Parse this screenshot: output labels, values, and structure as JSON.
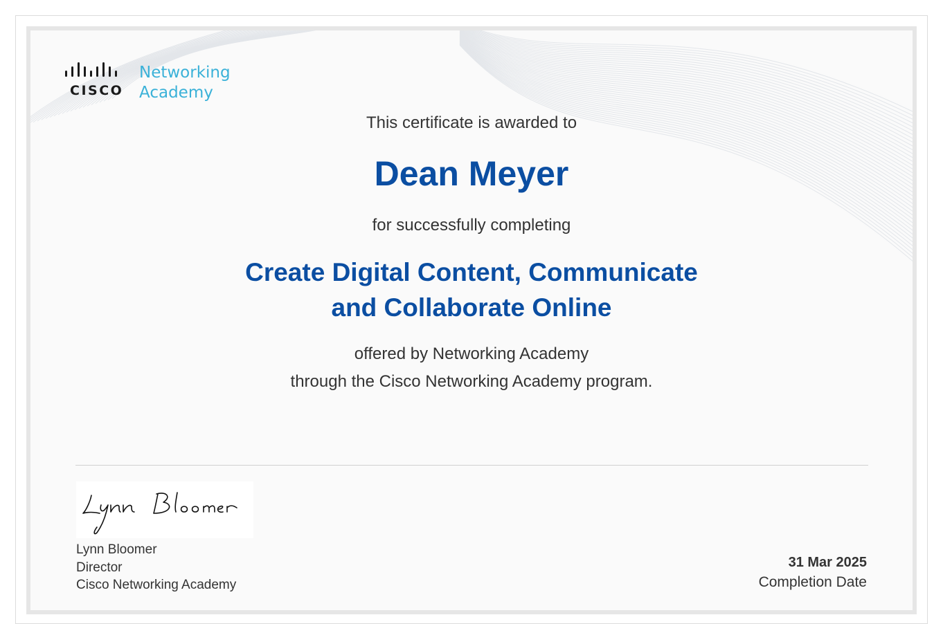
{
  "brand": {
    "cisco_wordmark": "CISCO",
    "academy_line1": "Networking",
    "academy_line2": "Academy",
    "accent_color": "#3ab1d8",
    "title_color": "#0b4ea2"
  },
  "certificate": {
    "awarded_text": "This certificate is awarded to",
    "recipient": "Dean Meyer",
    "completing_text": "for successfully completing",
    "course_line1": "Create Digital Content, Communicate",
    "course_line2": "and Collaborate Online",
    "offered_line1": "offered by Networking Academy",
    "offered_line2": "through the Cisco Networking Academy program."
  },
  "signatory": {
    "signature_script": "Lynn Bloomer",
    "name": "Lynn Bloomer",
    "title": "Director",
    "organization": "Cisco Networking Academy"
  },
  "completion": {
    "date": "31 Mar 2025",
    "label": "Completion Date"
  }
}
